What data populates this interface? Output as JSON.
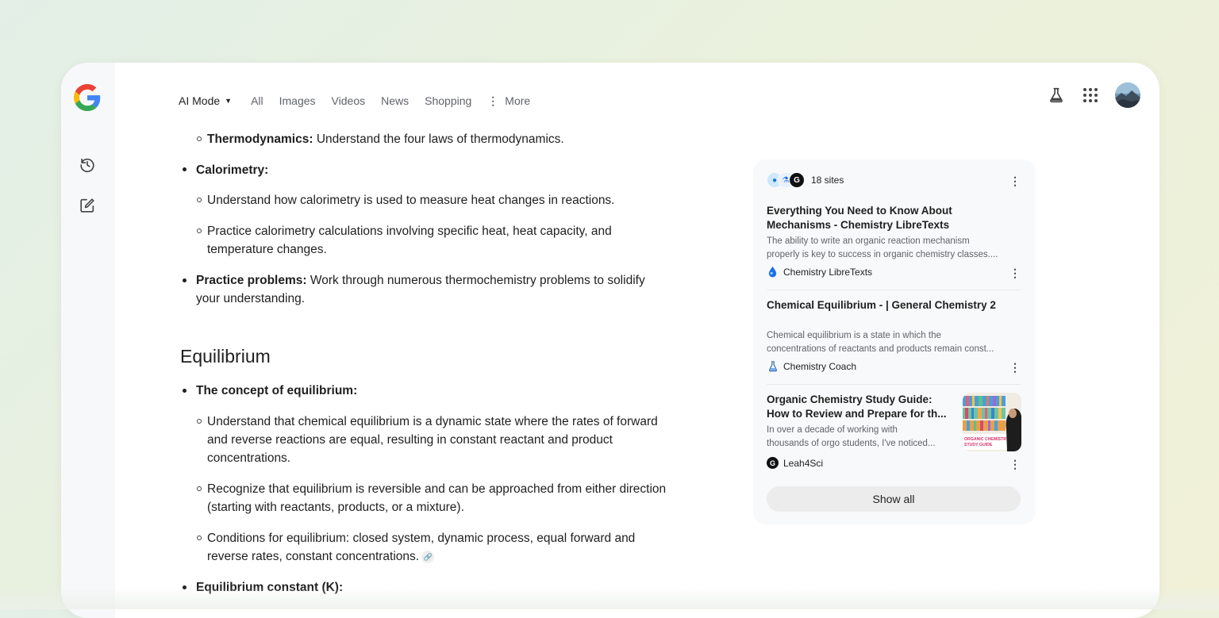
{
  "nav": {
    "ai_mode": "AI Mode",
    "tabs": [
      "All",
      "Images",
      "Videos",
      "News",
      "Shopping"
    ],
    "more": "More"
  },
  "icons": {
    "logo": "google-g-logo",
    "history": "history-icon",
    "new_chat": "edit-icon",
    "labs": "flask-icon",
    "apps": "apps-grid-icon",
    "avatar": "user-avatar"
  },
  "colors": {
    "google_blue": "#4285F4",
    "google_red": "#EA4335",
    "google_yellow": "#FBBC05",
    "google_green": "#34A853"
  },
  "content": {
    "thermo_term": "Thermodynamics:",
    "thermo_text": " Understand the four laws of thermodynamics.",
    "calorimetry": "Calorimetry:",
    "calorimetry_items": [
      "Understand how calorimetry is used to measure heat changes in reactions.",
      "Practice calorimetry calculations involving specific heat, heat capacity, and",
      "temperature changes."
    ],
    "practice_term": "Practice problems:",
    "practice_text_1": " Work through numerous thermochemistry problems to solidify",
    "practice_text_2": "your understanding.",
    "equilibrium_heading": "Equilibrium",
    "concept": "The concept of equilibrium:",
    "concept_items": [
      "Understand that chemical equilibrium is a dynamic state where the rates of forward",
      "and reverse reactions are equal, resulting in constant reactant and product",
      "concentrations.",
      "Recognize that equilibrium is reversible and can be approached from either direction",
      "(starting with reactants, products, or a mixture).",
      "Conditions for equilibrium: closed system, dynamic process, equal forward and",
      "reverse rates, constant concentrations."
    ],
    "constant": "Equilibrium constant (K):"
  },
  "sources": {
    "count_label": "18 sites",
    "cards": [
      {
        "title_1": "Everything You Need to Know About",
        "title_2": "Mechanisms - Chemistry LibreTexts",
        "snippet_1": "The ability to write an organic reaction mechanism",
        "snippet_2": "properly is key to success in organic chemistry classes....",
        "source": "Chemistry LibreTexts"
      },
      {
        "title_1": "Chemical Equilibrium - | General Chemistry 2",
        "snippet_1": "Chemical equilibrium is a state in which the",
        "snippet_2": "concentrations of reactants and products remain const...",
        "source": "Chemistry Coach"
      },
      {
        "title_1": "Organic Chemistry Study Guide:",
        "title_2": "How to Review and Prepare for th...",
        "snippet_1": "In over a decade of working with",
        "snippet_2": "thousands of orgo students, I've noticed...",
        "source": "Leah4Sci",
        "thumb_text": "ORGANIC CHEMISTRY STUDY GUIDE"
      }
    ],
    "show_all": "Show all"
  }
}
